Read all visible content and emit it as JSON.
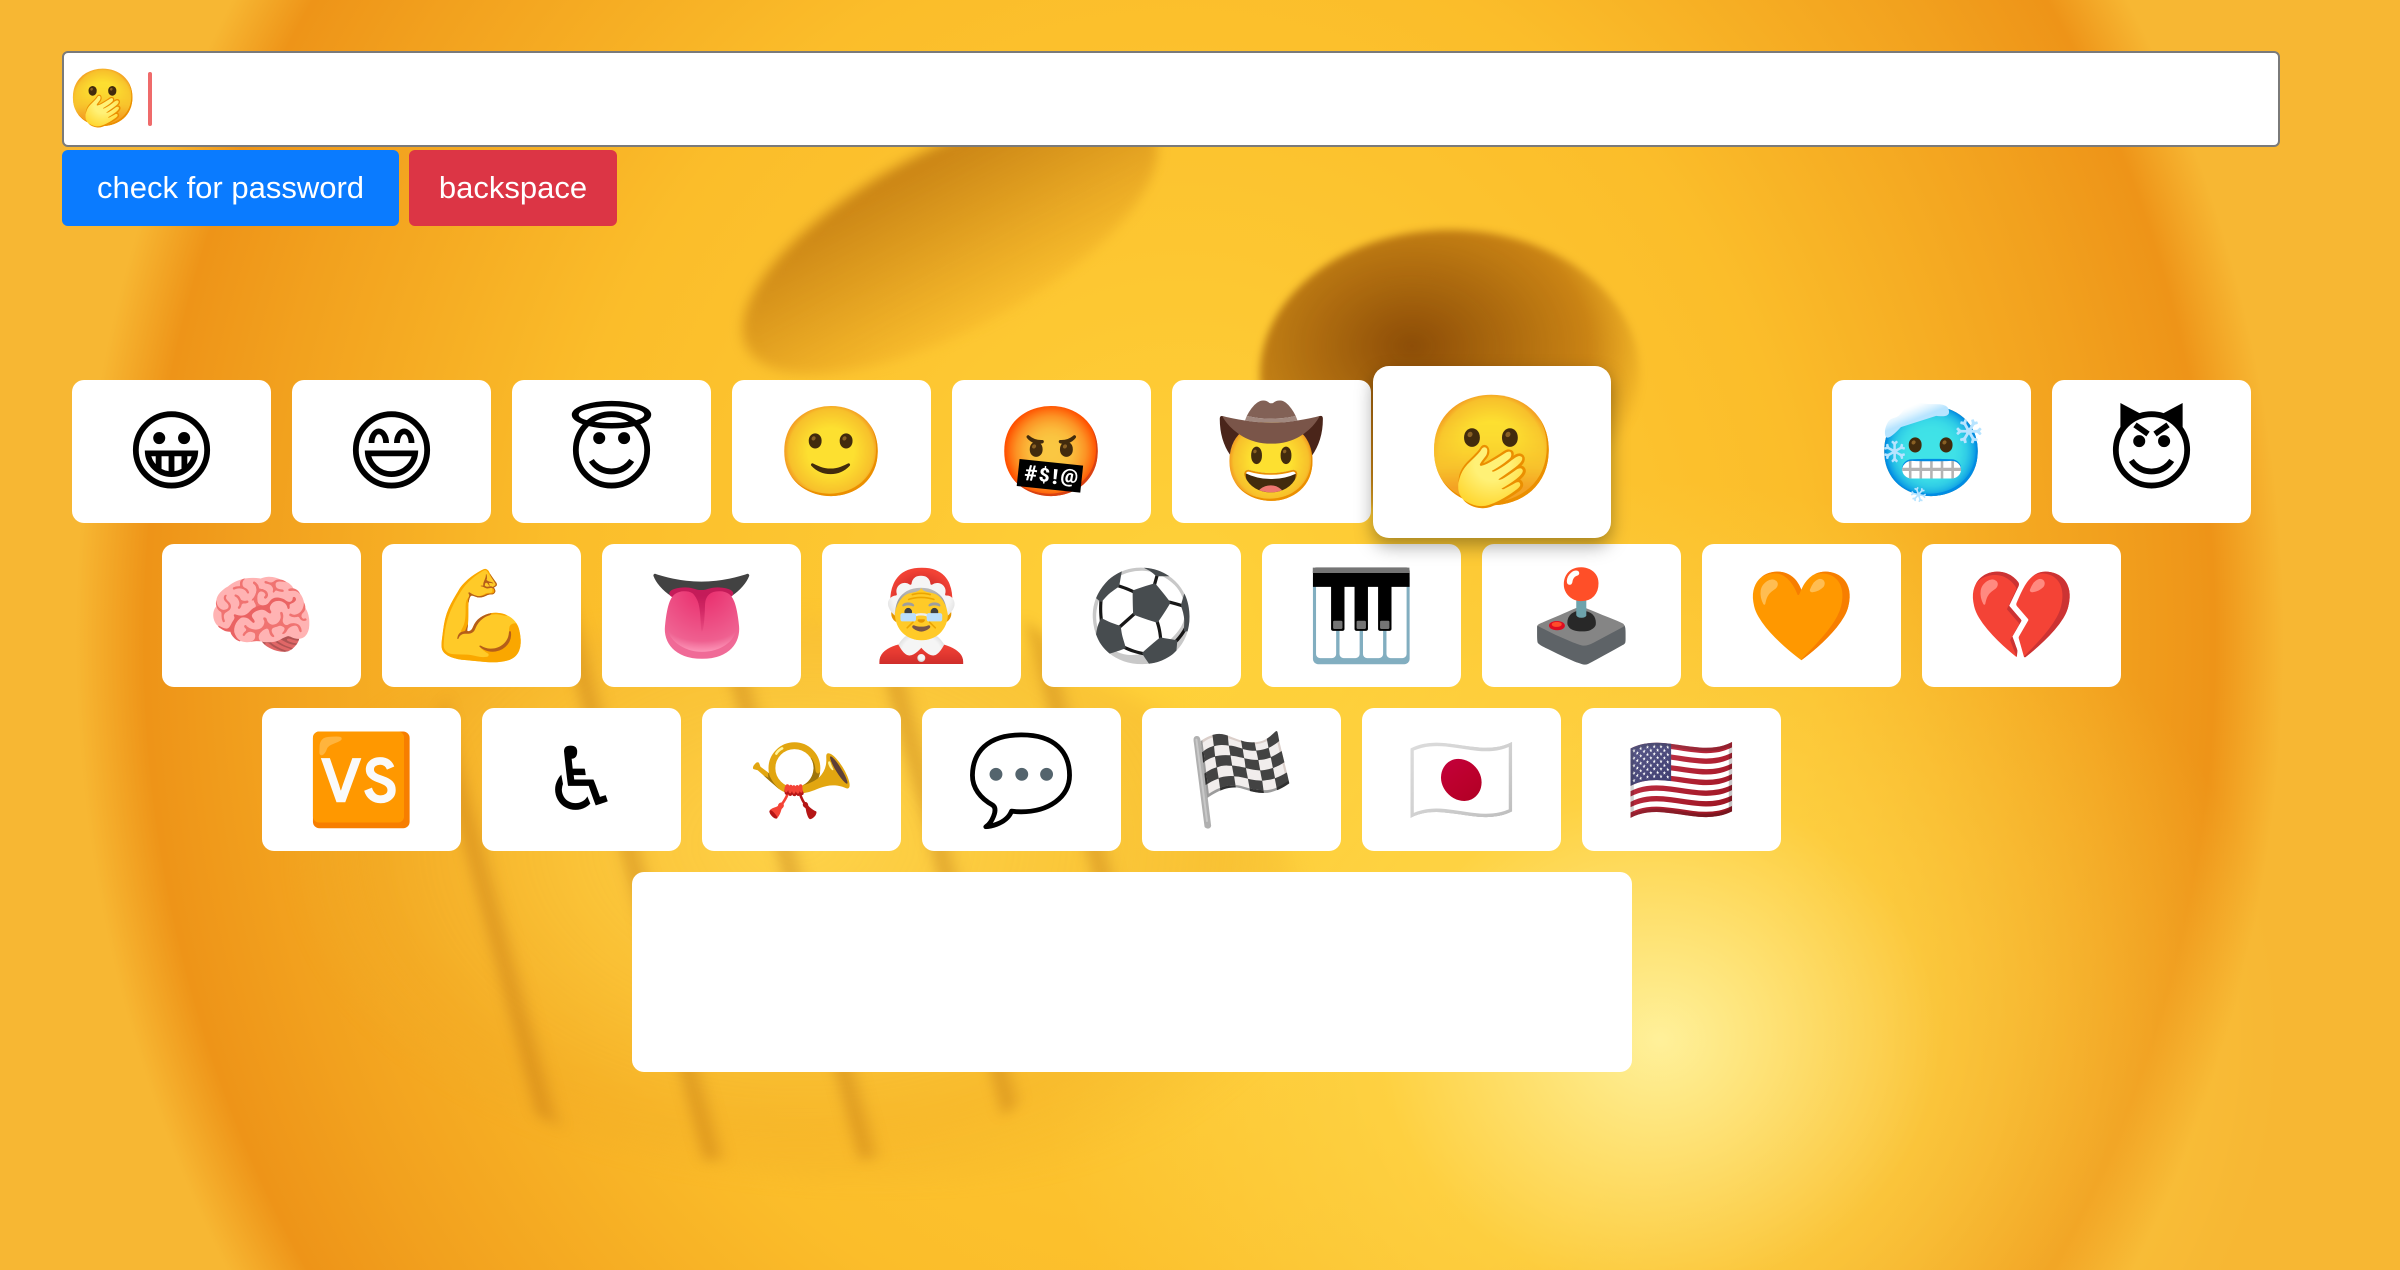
{
  "input": {
    "value": "🫢"
  },
  "buttons": {
    "check_label": "check for password",
    "backspace_label": "backspace"
  },
  "keyboard": {
    "row1": [
      "😀",
      "😄",
      "😇",
      "🙂",
      "🤬",
      "🤠",
      "🫢",
      "💩",
      "🥶",
      "😈"
    ],
    "row2": [
      "🧠",
      "💪",
      "👅",
      "🤶",
      "⚽",
      "🎹",
      "🕹️",
      "🧡",
      "💔"
    ],
    "row3": [
      "🆚",
      "♿",
      "📯",
      "💬",
      "🏁",
      "🇯🇵",
      "🇺🇸"
    ],
    "highlighted_key": "🫢"
  },
  "colors": {
    "check_button": "#0a7bff",
    "backspace_button": "#dc3545",
    "background": "#f7b733",
    "caret": "#ef6b6b"
  }
}
